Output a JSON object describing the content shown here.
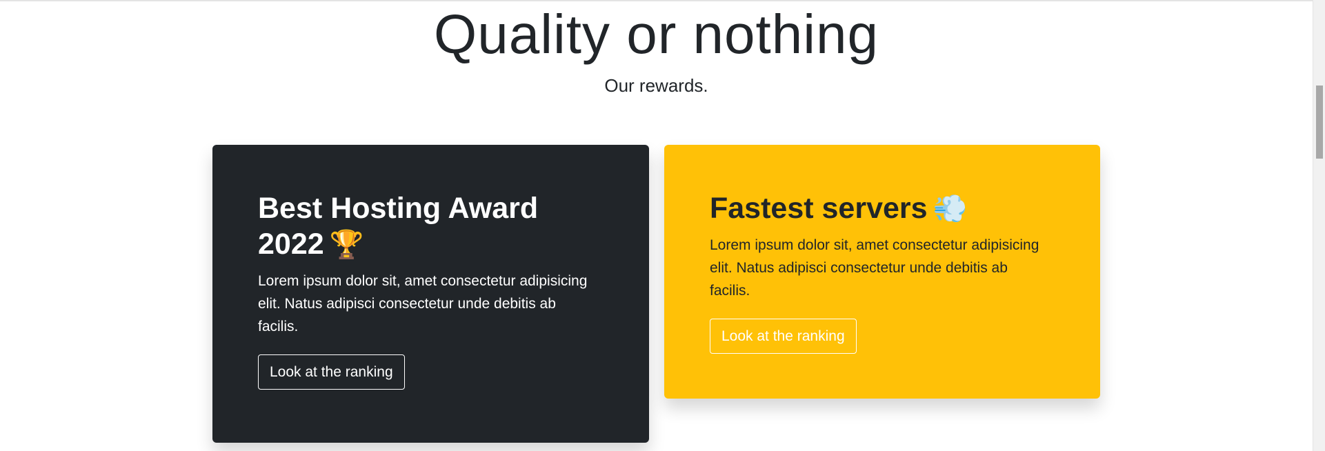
{
  "section": {
    "title": "Quality or nothing",
    "subtitle": "Our rewards."
  },
  "cards": [
    {
      "title": "Best Hosting Award 2022",
      "icon": "trophy-icon",
      "icon_glyph": "🏆",
      "text": "Lorem ipsum dolor sit, amet consectetur adipisicing elit. Natus adipisci consectetur unde debitis ab facilis.",
      "button_label": "Look at the ranking",
      "background": "#212529"
    },
    {
      "title": "Fastest servers",
      "icon": "dash-icon",
      "icon_glyph": "💨",
      "text": "Lorem ipsum dolor sit, amet consectetur adipisicing elit. Natus adipisci consectetur unde debitis ab facilis.",
      "button_label": "Look at the ranking",
      "background": "#ffc107"
    }
  ]
}
